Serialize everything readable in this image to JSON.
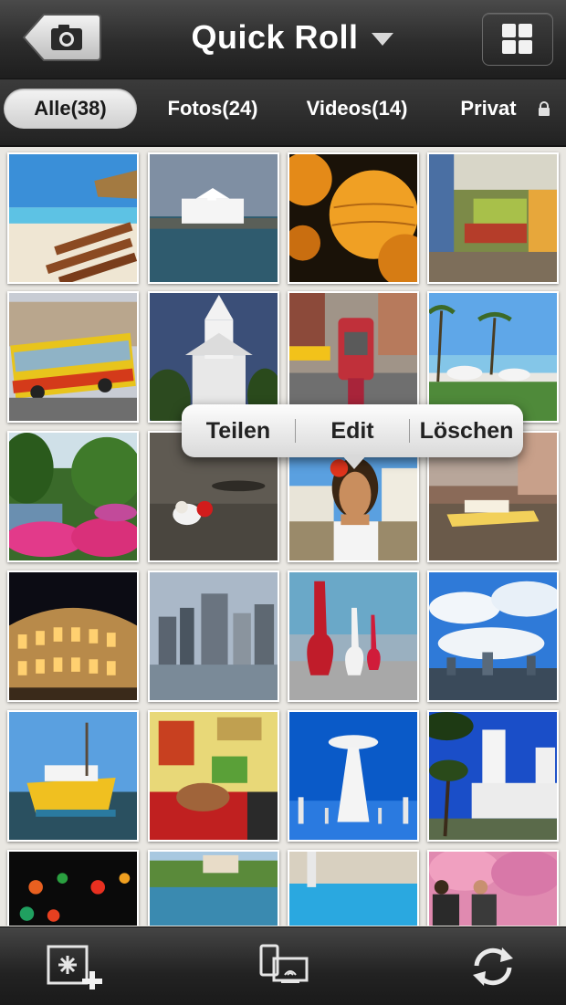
{
  "header": {
    "title": "Quick Roll",
    "back_icon": "camera-icon",
    "view_icon": "grid-view-icon"
  },
  "tabs": [
    {
      "label": "Alle(38)",
      "active": true
    },
    {
      "label": "Fotos(24)",
      "active": false
    },
    {
      "label": "Videos(14)",
      "active": false
    },
    {
      "label": "Privat",
      "active": false,
      "icon": "lock-icon"
    }
  ],
  "popover": {
    "items": [
      "Teilen",
      "Edit",
      "Löschen"
    ]
  },
  "photos": [
    {
      "subject": "beach with huts and lounge chairs"
    },
    {
      "subject": "white chapel by the sea"
    },
    {
      "subject": "orange paper lanterns"
    },
    {
      "subject": "colorful lounge interior"
    },
    {
      "subject": "yellow and red city bus"
    },
    {
      "subject": "white church steeple"
    },
    {
      "subject": "red fire alarm box on street"
    },
    {
      "subject": "palm trees and outdoor tables"
    },
    {
      "subject": "forest pond with pink azaleas"
    },
    {
      "subject": "small dog with red ball"
    },
    {
      "subject": "woman with red flower in hair"
    },
    {
      "subject": "yacht on river with skyline"
    },
    {
      "subject": "Colosseum at night"
    },
    {
      "subject": "city skyline across water"
    },
    {
      "subject": "red guitar sculptures"
    },
    {
      "subject": "blue sky with clouds over skyline"
    },
    {
      "subject": "yellow fishing boats"
    },
    {
      "subject": "colorful art room"
    },
    {
      "subject": "white tower against blue sky"
    },
    {
      "subject": "white mission church with palm"
    },
    {
      "subject": "lanterns at night"
    },
    {
      "subject": "coastal village"
    },
    {
      "subject": "swimming pool"
    },
    {
      "subject": "people under cherry blossoms"
    }
  ],
  "toolbar": {
    "add_icon": "add-photo-icon",
    "share_icon": "airplay-devices-icon",
    "refresh_icon": "refresh-icon"
  },
  "colors": {
    "bar_dark": "#2c2c2c",
    "active_tab": "#e6e6e6",
    "grid_background": "#e9e7e2"
  }
}
